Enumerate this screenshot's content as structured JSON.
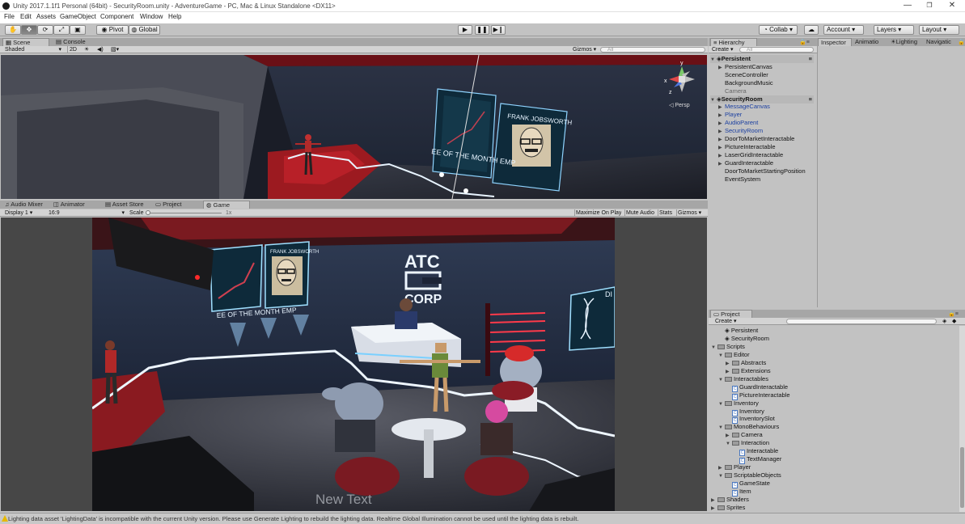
{
  "window": {
    "title": "Unity 2017.1.1f1 Personal (64bit) - SecurityRoom.unity - AdventureGame - PC, Mac & Linux Standalone <DX11>",
    "min_glyph": "—",
    "max_glyph": "❐",
    "close_glyph": "✕"
  },
  "menu": [
    "File",
    "Edit",
    "Assets",
    "GameObject",
    "Component",
    "Window",
    "Help"
  ],
  "toolbar": {
    "pivot_label": "Pivot",
    "global_label": "Global",
    "collab_label": "Collab ▾",
    "account_label": "Account",
    "layers_label": "Layers",
    "layout_label": "Layout"
  },
  "scene_panel": {
    "tabs": [
      "Scene",
      "Console"
    ],
    "shading_mode": "Shaded",
    "mode_2d": "2D",
    "gizmos_label": "Gizmos",
    "search_placeholder": "All",
    "persp_label": "Persp"
  },
  "game_panel": {
    "tabs": [
      "Audio Mixer",
      "Animator",
      "Asset Store",
      "Project",
      "Game"
    ],
    "display": "Display 1",
    "aspect": "16:9",
    "scale_label": "Scale",
    "scale_value": "1x",
    "buttons": [
      "Maximize On Play",
      "Mute Audio",
      "Stats",
      "Gizmos"
    ],
    "overlay_text": "New Text"
  },
  "scene_art": {
    "poster_name": "FRANK JOBSWORTH",
    "poster_caption": "EE OF THE MONTH  EMP"
  },
  "game_art": {
    "company_line1": "ATC",
    "company_line2": "CORP",
    "poster_name": "FRANK JOBSWORTH",
    "poster_caption": "EE OF THE MONTH  EMP",
    "side_sign": "DI"
  },
  "hierarchy": {
    "tab_label": "Hierarchy",
    "create_label": "Create",
    "search_placeholder": "All",
    "items": [
      {
        "label": "Persistent",
        "depth": 0,
        "type": "scene"
      },
      {
        "label": "PersistentCanvas",
        "depth": 1,
        "expandable": true
      },
      {
        "label": "SceneController",
        "depth": 1
      },
      {
        "label": "BackgroundMusic",
        "depth": 1
      },
      {
        "label": "Camera",
        "depth": 1,
        "dim": true
      },
      {
        "label": "SecurityRoom",
        "depth": 0,
        "type": "scene"
      },
      {
        "label": "MessageCanvas",
        "depth": 1,
        "expandable": true,
        "blue": true
      },
      {
        "label": "Player",
        "depth": 1,
        "expandable": true,
        "blue": true
      },
      {
        "label": "AudioParent",
        "depth": 1,
        "expandable": true,
        "blue": true
      },
      {
        "label": "SecurityRoom",
        "depth": 1,
        "expandable": true,
        "blue": true
      },
      {
        "label": "DoorToMarketInteractable",
        "depth": 1,
        "expandable": true
      },
      {
        "label": "PictureInteractable",
        "depth": 1,
        "expandable": true
      },
      {
        "label": "LaserGridInteractable",
        "depth": 1,
        "expandable": true
      },
      {
        "label": "GuardInteractable",
        "depth": 1,
        "expandable": true
      },
      {
        "label": "DoorToMarketStartingPosition",
        "depth": 1
      },
      {
        "label": "EventSystem",
        "depth": 1
      }
    ]
  },
  "inspector": {
    "tabs": [
      "Inspector",
      "Animatio",
      "Lighting",
      "Navigatic"
    ]
  },
  "project": {
    "tab_label": "Project",
    "create_label": "Create",
    "items": [
      {
        "label": "Persistent",
        "depth": 1,
        "icon": "unity"
      },
      {
        "label": "SecurityRoom",
        "depth": 1,
        "icon": "unity"
      },
      {
        "label": "Scripts",
        "depth": 0,
        "icon": "folder",
        "open": true
      },
      {
        "label": "Editor",
        "depth": 1,
        "icon": "folder",
        "open": true
      },
      {
        "label": "Abstracts",
        "depth": 2,
        "icon": "folder"
      },
      {
        "label": "Extensions",
        "depth": 2,
        "icon": "folder"
      },
      {
        "label": "Interactables",
        "depth": 1,
        "icon": "folder",
        "open": true
      },
      {
        "label": "GuardInteractable",
        "depth": 2,
        "icon": "script"
      },
      {
        "label": "PictureInteractable",
        "depth": 2,
        "icon": "script"
      },
      {
        "label": "Inventory",
        "depth": 1,
        "icon": "folder",
        "open": true
      },
      {
        "label": "Inventory",
        "depth": 2,
        "icon": "script"
      },
      {
        "label": "InventorySlot",
        "depth": 2,
        "icon": "script"
      },
      {
        "label": "MonoBehaviours",
        "depth": 1,
        "icon": "folder",
        "open": true
      },
      {
        "label": "Camera",
        "depth": 2,
        "icon": "folder"
      },
      {
        "label": "Interaction",
        "depth": 2,
        "icon": "folder",
        "open": true
      },
      {
        "label": "Interactable",
        "depth": 3,
        "icon": "script"
      },
      {
        "label": "TextManager",
        "depth": 3,
        "icon": "script"
      },
      {
        "label": "Player",
        "depth": 1,
        "icon": "folder"
      },
      {
        "label": "ScriptableObjects",
        "depth": 1,
        "icon": "folder",
        "open": true
      },
      {
        "label": "GameState",
        "depth": 2,
        "icon": "script"
      },
      {
        "label": "Item",
        "depth": 2,
        "icon": "script"
      },
      {
        "label": "Shaders",
        "depth": 0,
        "icon": "folder"
      },
      {
        "label": "Sprites",
        "depth": 0,
        "icon": "folder"
      }
    ]
  },
  "status": {
    "message": "Lighting data asset 'LightingData' is incompatible with the current Unity version. Please use Generate Lighting to rebuild the lighting data.  Realtime Global Illumination cannot be used until the lighting data is rebuilt."
  },
  "colors": {
    "editor_bg": "#c2c2c2",
    "accent_blue": "#1b3fa0",
    "scene_red": "#b01820",
    "neon_white": "#e8f4ff"
  }
}
